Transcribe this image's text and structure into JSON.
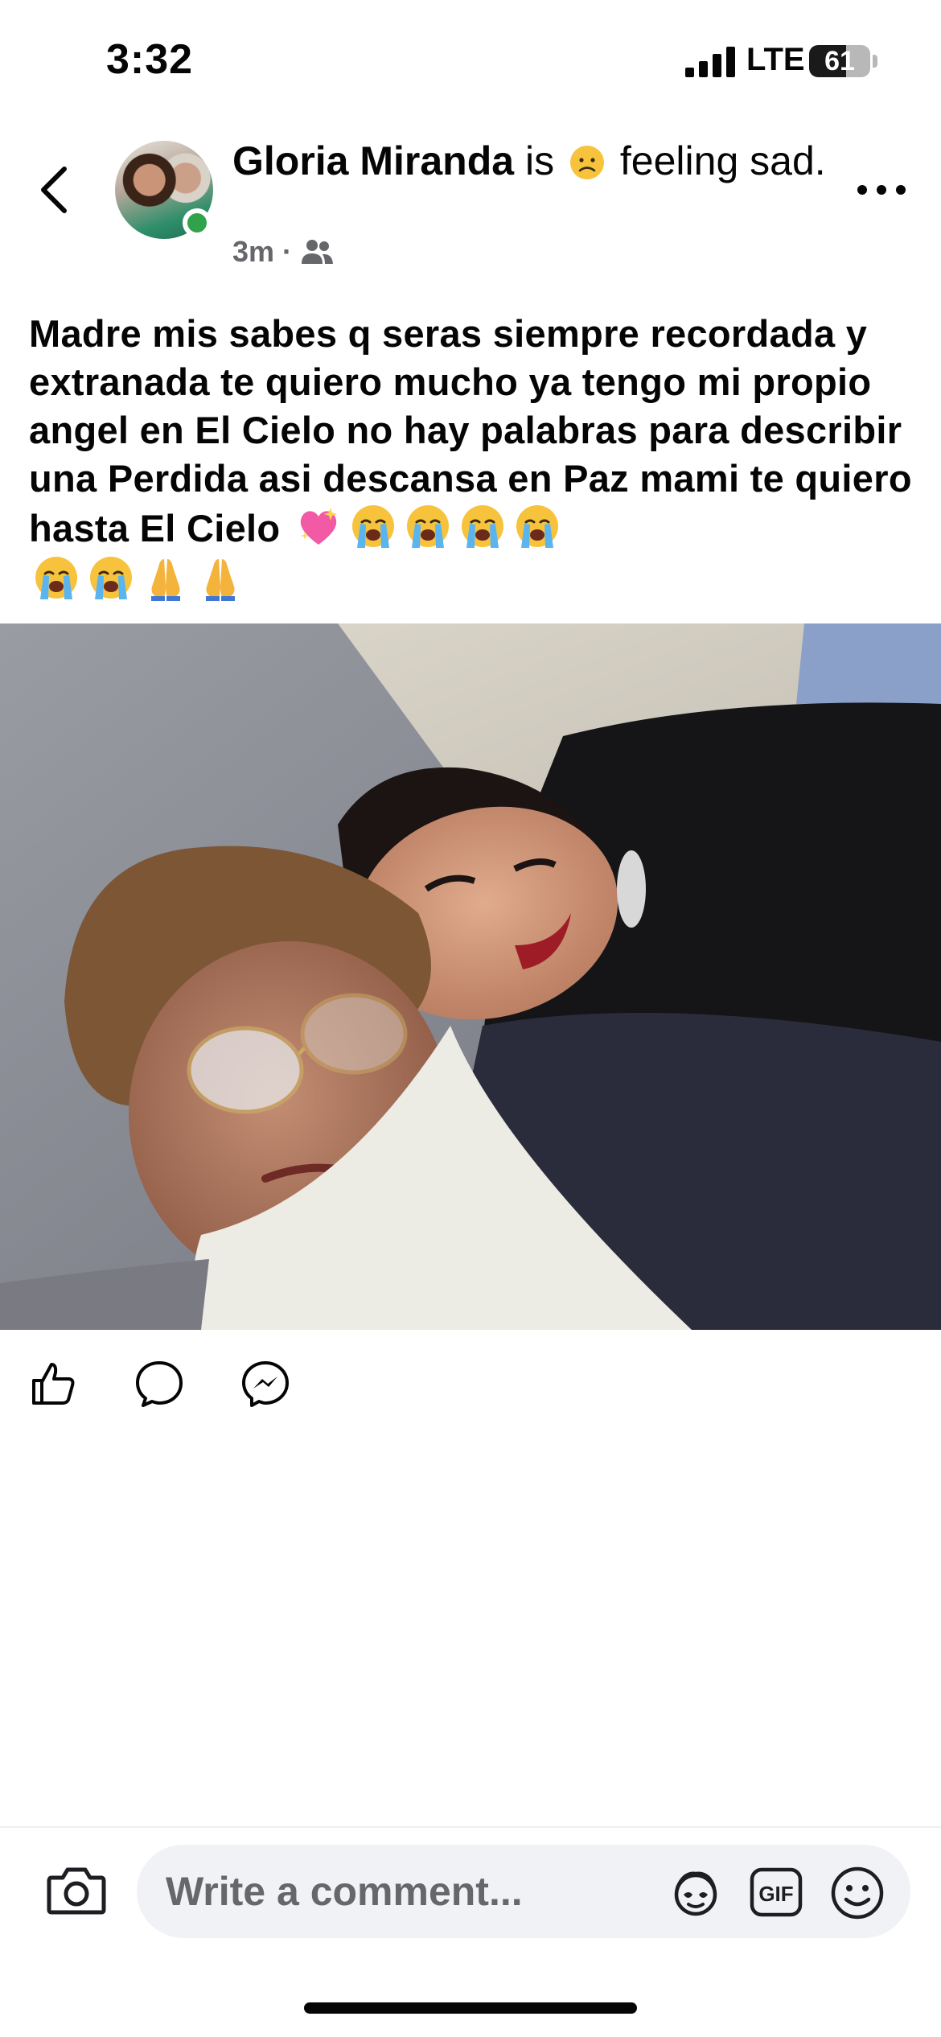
{
  "status_bar": {
    "time": "3:32",
    "network": "LTE",
    "battery_level": "61",
    "battery_fraction": 0.61
  },
  "post": {
    "author": "Gloria Miranda",
    "feeling_prefix": "is",
    "feeling_text": "feeling sad.",
    "time_ago": "3m",
    "audience_icon": "friends-icon",
    "text": "Madre mis sabes q seras siempre recordada y extranada te quiero mucho ya tengo mi propio angel en El Cielo  no hay palabras para describir una Perdida asi descansa en Paz mami te quiero hasta El Cielo",
    "emojis_line1": [
      "sparkling-heart",
      "loudly-crying-face",
      "loudly-crying-face",
      "loudly-crying-face",
      "loudly-crying-face"
    ],
    "emojis_line2": [
      "loudly-crying-face",
      "loudly-crying-face",
      "folded-hands",
      "folded-hands"
    ]
  },
  "actions": {
    "icons": [
      "like-icon",
      "comment-icon",
      "messenger-icon"
    ]
  },
  "comment_bar": {
    "placeholder": "Write a comment...",
    "icons": [
      "camera-icon",
      "avatar-sticker-icon",
      "gif-icon",
      "emoji-icon"
    ],
    "gif_label": "GIF"
  },
  "colors": {
    "online": "#31a24c",
    "secondary_text": "#65676b",
    "input_bg": "#f0f2f5"
  }
}
